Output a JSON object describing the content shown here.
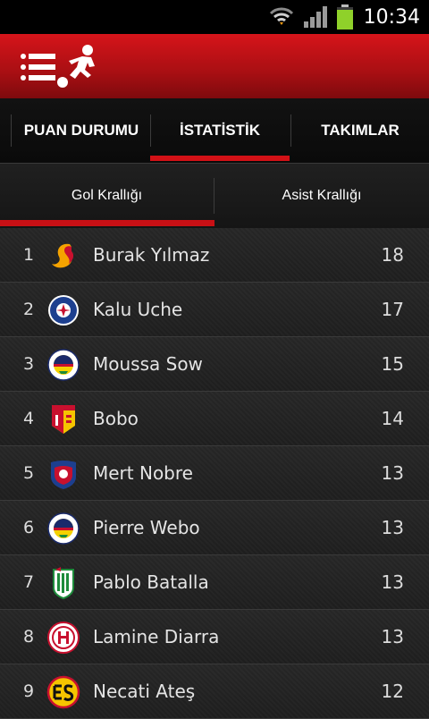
{
  "status_bar": {
    "time": "10:34"
  },
  "header": {
    "menu_icon": "menu-icon",
    "logo_icon": "soccer-player-icon"
  },
  "tabs": [
    {
      "label": "PUAN DURUMU"
    },
    {
      "label": "İSTATİSTİK",
      "active": true
    },
    {
      "label": "TAKIMLAR"
    }
  ],
  "subtabs": [
    {
      "label": "Gol Krallığı",
      "active": true
    },
    {
      "label": "Asist Krallığı"
    }
  ],
  "scorers": [
    {
      "rank": "1",
      "name": "Burak Yılmaz",
      "goals": "18",
      "club_icon": "galatasaray-logo"
    },
    {
      "rank": "2",
      "name": "Kalu Uche",
      "goals": "17",
      "club_icon": "kasimpasa-logo"
    },
    {
      "rank": "3",
      "name": "Moussa Sow",
      "goals": "15",
      "club_icon": "fenerbahce-logo"
    },
    {
      "rank": "4",
      "name": "Bobo",
      "goals": "14",
      "club_icon": "kayserispor-logo"
    },
    {
      "rank": "5",
      "name": "Mert Nobre",
      "goals": "13",
      "club_icon": "mersin-idmanyurdu-logo"
    },
    {
      "rank": "6",
      "name": "Pierre Webo",
      "goals": "13",
      "club_icon": "fenerbahce-logo"
    },
    {
      "rank": "7",
      "name": "Pablo Batalla",
      "goals": "13",
      "club_icon": "bursaspor-logo"
    },
    {
      "rank": "8",
      "name": "Lamine Diarra",
      "goals": "13",
      "club_icon": "antalyaspor-logo"
    },
    {
      "rank": "9",
      "name": "Necati Ateş",
      "goals": "12",
      "club_icon": "eskisehirspor-logo"
    }
  ],
  "colors": {
    "accent": "#d21116",
    "header_red": "#c4121a"
  }
}
